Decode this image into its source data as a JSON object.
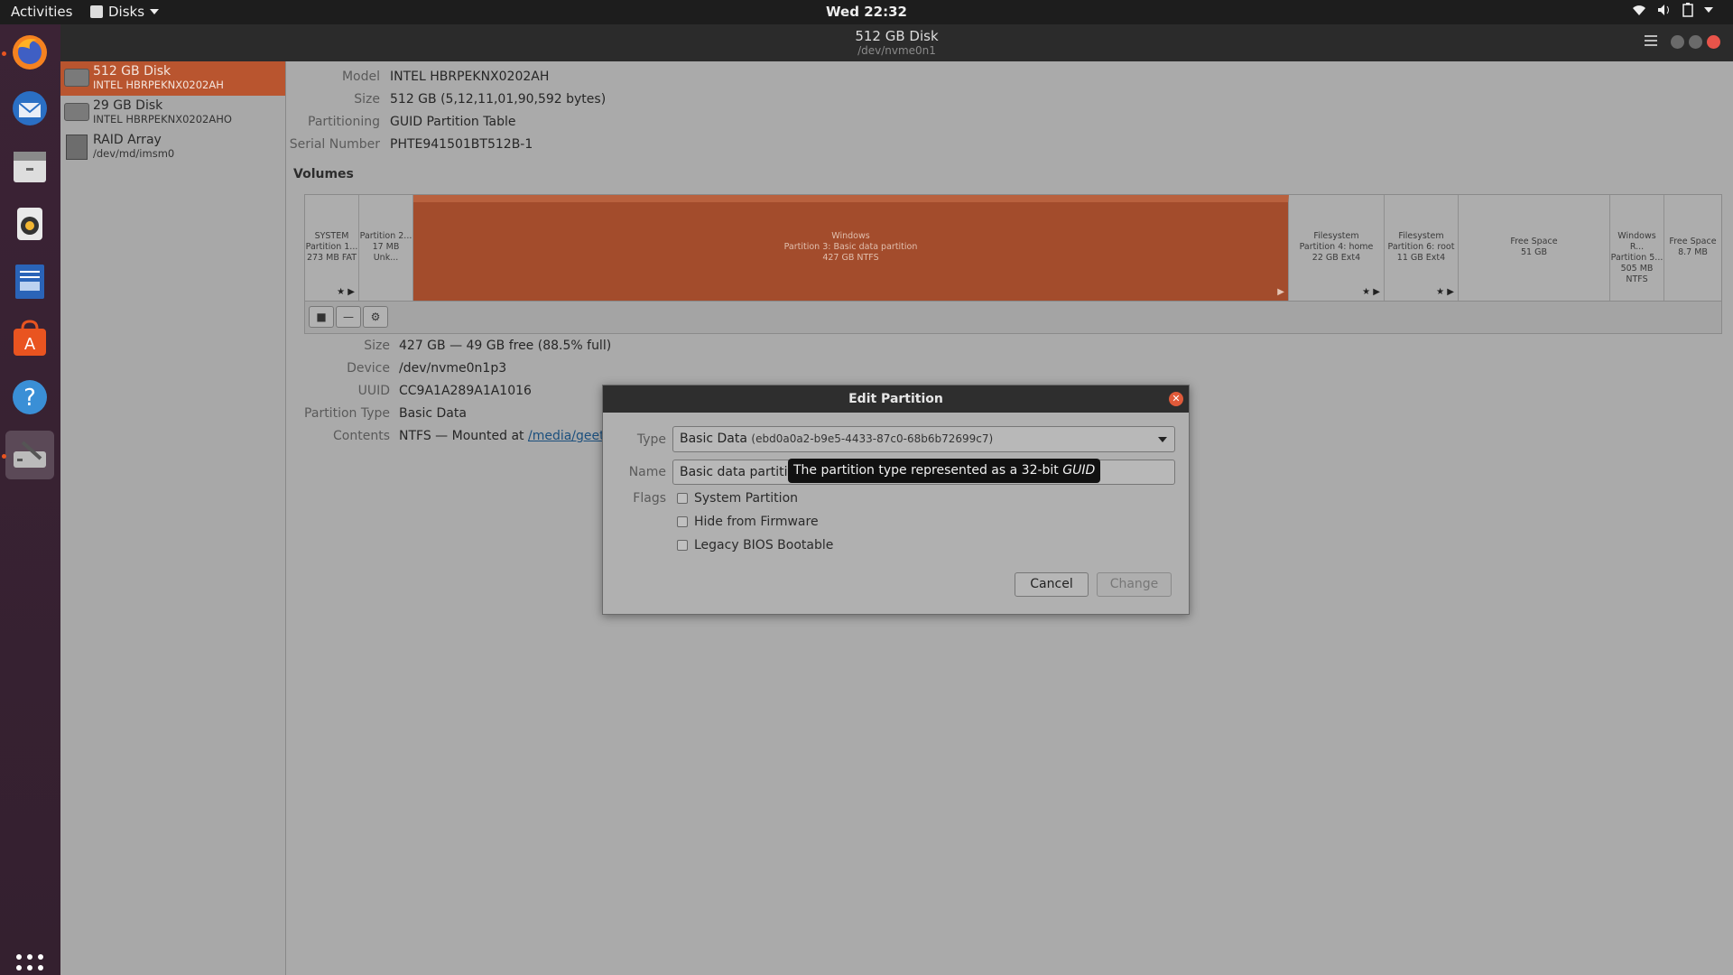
{
  "topbar": {
    "activities": "Activities",
    "app_menu": "Disks",
    "clock": "Wed 22:32"
  },
  "window": {
    "title": "512 GB Disk",
    "subtitle": "/dev/nvme0n1"
  },
  "sidebar": {
    "disks": [
      {
        "name": "512 GB Disk",
        "sub": "INTEL HBRPEKNX0202AH",
        "selected": true
      },
      {
        "name": "29 GB Disk",
        "sub": "INTEL HBRPEKNX0202AHO",
        "selected": false
      },
      {
        "name": "RAID Array",
        "sub": "/dev/md/imsm0",
        "selected": false
      }
    ]
  },
  "disk_info": {
    "model_label": "Model",
    "model": "INTEL HBRPEKNX0202AH",
    "size_label": "Size",
    "size": "512 GB (5,12,11,01,90,592 bytes)",
    "partitioning_label": "Partitioning",
    "partitioning": "GUID Partition Table",
    "serial_label": "Serial Number",
    "serial": "PHTE941501BT512B-1"
  },
  "volumes": {
    "label": "Volumes",
    "segments": [
      {
        "l1": "SYSTEM",
        "l2": "Partition 1...",
        "l3": "273 MB FAT",
        "icons": "★ ▶"
      },
      {
        "l1": "Partition 2...",
        "l2": "17 MB Unk...",
        "l3": "",
        "icons": ""
      },
      {
        "l1": "Windows",
        "l2": "Partition 3: Basic data partition",
        "l3": "427 GB NTFS",
        "icons": "▶"
      },
      {
        "l1": "Filesystem",
        "l2": "Partition 4: home",
        "l3": "22 GB Ext4",
        "icons": "★ ▶"
      },
      {
        "l1": "Filesystem",
        "l2": "Partition 6: root",
        "l3": "11 GB Ext4",
        "icons": "★ ▶"
      },
      {
        "l1": "Free Space",
        "l2": "51 GB",
        "l3": "",
        "icons": ""
      },
      {
        "l1": "Windows R...",
        "l2": "Partition 5...",
        "l3": "505 MB NTFS",
        "icons": ""
      },
      {
        "l1": "Free Space",
        "l2": "8.7 MB",
        "l3": "",
        "icons": ""
      }
    ],
    "tools": {
      "stop": "■",
      "remove": "—",
      "settings": "⚙"
    }
  },
  "partition_info": {
    "size_label": "Size",
    "size": "427 GB — 49 GB free (88.5% full)",
    "device_label": "Device",
    "device": "/dev/nvme0n1p3",
    "uuid_label": "UUID",
    "uuid": "CC9A1A289A1A1016",
    "ptype_label": "Partition Type",
    "ptype": "Basic Data",
    "contents_label": "Contents",
    "contents_prefix": "NTFS — Mounted at",
    "contents_link": "/media/geeti"
  },
  "dialog": {
    "title": "Edit Partition",
    "close": "✕",
    "type_label": "Type",
    "type_value": "Basic Data",
    "type_guid": "(ebd0a0a2-b9e5-4433-87c0-68b6b72699c7)",
    "name_label": "Name",
    "name_value": "Basic data partitio",
    "flags_label": "Flags",
    "flags": [
      "System Partition",
      "Hide from Firmware",
      "Legacy BIOS Bootable"
    ],
    "cancel": "Cancel",
    "change": "Change"
  },
  "tooltip": {
    "text": "The partition type represented as a 32-bit",
    "emph": "GUID"
  },
  "colors": {
    "accent": "#e95420",
    "selected_partition": "#a34c2c"
  }
}
